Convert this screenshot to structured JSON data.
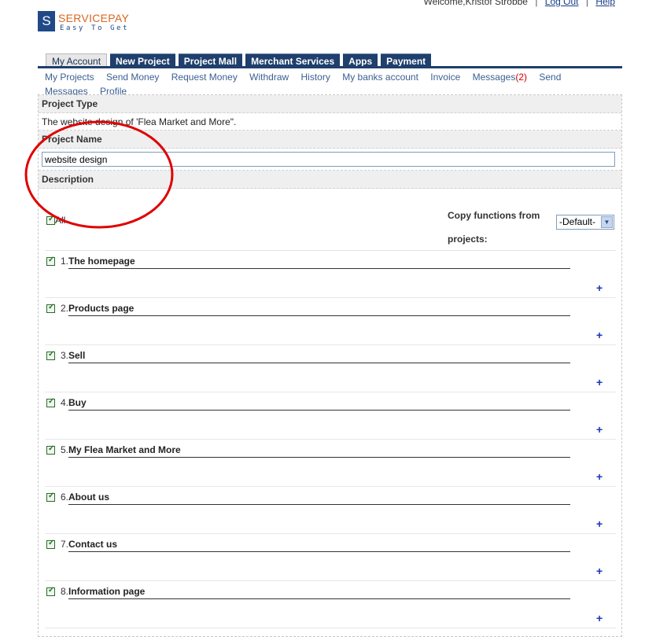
{
  "header": {
    "welcome": "Welcome,Kristof Strobbe",
    "logout": "Log Out",
    "separator": "|",
    "help": "Help"
  },
  "logo": {
    "mark": "S",
    "brand": "SERVICEPAY",
    "tagline": "Easy To Get"
  },
  "tabs": [
    {
      "label": "My Account",
      "active": true
    },
    {
      "label": "New Project",
      "active": false
    },
    {
      "label": "Project Mall",
      "active": false
    },
    {
      "label": "Merchant Services",
      "active": false
    },
    {
      "label": "Apps",
      "active": false
    },
    {
      "label": "Payment",
      "active": false
    }
  ],
  "subnav": {
    "items": [
      "My Projects",
      "Send Money",
      "Request Money",
      "Withdraw",
      "History",
      "My banks account",
      "Invoice"
    ],
    "messages_label": "Messages",
    "messages_count": "(2)",
    "send_messages": "Send Messages",
    "profile": "Profile"
  },
  "form": {
    "project_type_heading": "Project Type",
    "project_type_value": "The website design of 'Flea Market and More\".",
    "project_name_heading": "Project Name",
    "project_name_value": "website design",
    "description_heading": "Description"
  },
  "functions": {
    "all_label": "All",
    "all_checked": true,
    "copy_label": "Copy functions from projects:",
    "copy_select_value": "-Default-",
    "add_symbol": "+",
    "items": [
      {
        "num": "1.",
        "title": "The homepage",
        "checked": true
      },
      {
        "num": "2.",
        "title": "Products page",
        "checked": true
      },
      {
        "num": "3.",
        "title": "Sell",
        "checked": true
      },
      {
        "num": "4.",
        "title": "Buy",
        "checked": true
      },
      {
        "num": "5.",
        "title": "My Flea Market and More",
        "checked": true
      },
      {
        "num": "6.",
        "title": "About us",
        "checked": true
      },
      {
        "num": "7.",
        "title": "Contact us",
        "checked": true
      },
      {
        "num": "8.",
        "title": "Information page",
        "checked": true
      }
    ]
  },
  "colors": {
    "nav_blue": "#1f3f6c",
    "brand_orange": "#d9661e",
    "annotation_red": "#e00000"
  }
}
